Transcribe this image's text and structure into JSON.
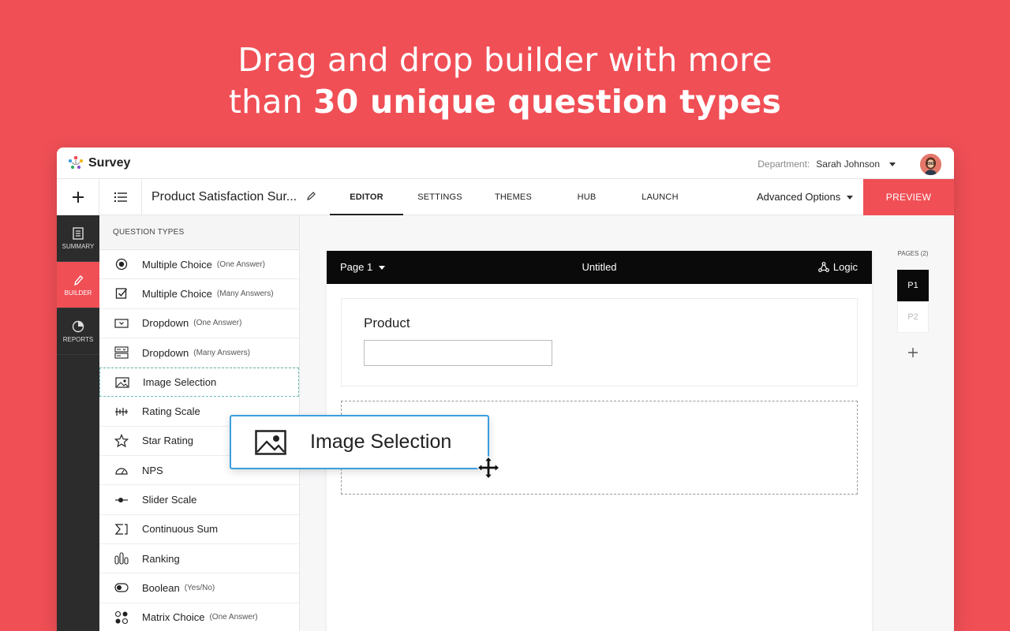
{
  "headline": {
    "line1": "Drag and drop builder with more",
    "line2_prefix": "than ",
    "line2_bold": "30 unique question types"
  },
  "topbar": {
    "app_name": "Survey",
    "department_label": "Department:",
    "user_name": "Sarah Johnson"
  },
  "navbar": {
    "survey_title": "Product Satisfaction Sur...",
    "tabs": [
      "EDITOR",
      "SETTINGS",
      "THEMES",
      "HUB",
      "LAUNCH"
    ],
    "active_tab": "EDITOR",
    "advanced_label": "Advanced Options",
    "preview_label": "PREVIEW"
  },
  "leftnav": {
    "items": [
      {
        "label": "SUMMARY",
        "icon": "document-icon"
      },
      {
        "label": "BUILDER",
        "icon": "pencil-icon"
      },
      {
        "label": "REPORTS",
        "icon": "pie-chart-icon"
      }
    ],
    "active": "BUILDER"
  },
  "question_panel": {
    "title": "QUESTION TYPES",
    "items": [
      {
        "label": "Multiple Choice",
        "sub": "(One Answer)",
        "icon": "radio-icon"
      },
      {
        "label": "Multiple Choice",
        "sub": "(Many Answers)",
        "icon": "checkbox-icon"
      },
      {
        "label": "Dropdown",
        "sub": "(One Answer)",
        "icon": "dropdown-icon"
      },
      {
        "label": "Dropdown",
        "sub": "(Many Answers)",
        "icon": "multi-dropdown-icon"
      },
      {
        "label": "Image Selection",
        "sub": "",
        "icon": "image-icon"
      },
      {
        "label": "Rating Scale",
        "sub": "",
        "icon": "rating-scale-icon"
      },
      {
        "label": "Star Rating",
        "sub": "",
        "icon": "star-icon"
      },
      {
        "label": "NPS",
        "sub": "",
        "icon": "gauge-icon"
      },
      {
        "label": "Slider Scale",
        "sub": "",
        "icon": "slider-icon"
      },
      {
        "label": "Continuous Sum",
        "sub": "",
        "icon": "sum-icon"
      },
      {
        "label": "Ranking",
        "sub": "",
        "icon": "ranking-icon"
      },
      {
        "label": "Boolean",
        "sub": "(Yes/No)",
        "icon": "toggle-icon"
      },
      {
        "label": "Matrix Choice",
        "sub": "(One Answer)",
        "icon": "matrix-icon"
      }
    ]
  },
  "page_editor": {
    "page_selector": "Page 1",
    "page_title": "Untitled",
    "logic_label": "Logic",
    "question_label": "Product"
  },
  "pages_panel": {
    "label": "PAGES (2)",
    "pages": [
      "P1",
      "P2"
    ],
    "active": "P1"
  },
  "drag_item": {
    "label": "Image Selection"
  },
  "colors": {
    "brand": "#f04f56",
    "drag_border": "#3a9ee0",
    "dark": "#0a0a0a"
  }
}
